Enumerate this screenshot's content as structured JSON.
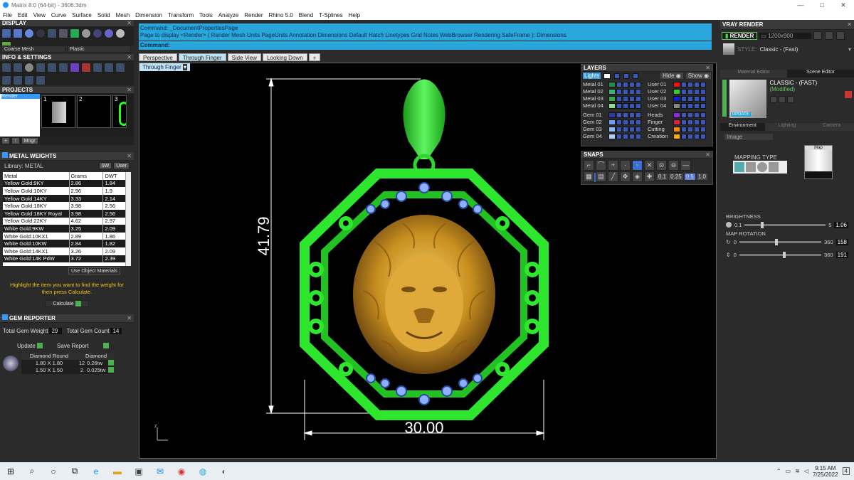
{
  "window": {
    "title": "Matrix 8.0 (64-bit) - 3606.3dm",
    "controls": [
      "—",
      "□",
      "✕"
    ]
  },
  "menu": [
    "File",
    "Edit",
    "View",
    "Curve",
    "Surface",
    "Solid",
    "Mesh",
    "Dimension",
    "Transform",
    "Tools",
    "Analyze",
    "Render",
    "Rhino 5.0",
    "Blend",
    "T-Splines",
    "Help"
  ],
  "left": {
    "display": {
      "title": "DISPLAY",
      "dropdown1": "Coarse Mesh",
      "dropdown2": "Plastic"
    },
    "info": {
      "title": "INFO & SETTINGS"
    },
    "projects": {
      "title": "PROJECTS",
      "item": "Render",
      "thumbs": [
        "1",
        "2",
        "3"
      ],
      "buttons": [
        "+",
        "↑",
        "Mngr"
      ]
    },
    "metal": {
      "title": "METAL WEIGHTS",
      "library_label": "Library: METAL",
      "toggle1": "0W",
      "toggle2": "User",
      "columns": [
        "Metal",
        "Grams",
        "DWT"
      ],
      "rows": [
        [
          "Yellow Gold:9KY",
          "2.86",
          "1.84"
        ],
        [
          "Yellow Gold:10KY",
          "2.96",
          "1.9"
        ],
        [
          "Yellow Gold:14KY",
          "3.33",
          "2.14"
        ],
        [
          "Yellow Gold:18KY",
          "3.98",
          "2.56"
        ],
        [
          "Yellow Gold:18KY Royal",
          "3.98",
          "2.56"
        ],
        [
          "Yellow Gold:22KY",
          "4.62",
          "2.97"
        ],
        [
          "White Gold:9KW",
          "3.25",
          "2.09"
        ],
        [
          "White Gold:10KX1",
          "2.89",
          "1.86"
        ],
        [
          "White Gold:10KW",
          "2.84",
          "1.82"
        ],
        [
          "White Gold:14KX1",
          "3.26",
          "2.09"
        ],
        [
          "White Gold:14K PdW",
          "3.72",
          "2.39"
        ]
      ],
      "use_object": "Use Object Materials",
      "hint": "Highlight the item you want to find the weight for then press Calculate.",
      "calculate": "Calculate"
    },
    "gem": {
      "title": "GEM REPORTER",
      "total_weight_label": "Total Gem Weight",
      "total_weight": "29",
      "total_count_label": "Total Gem Count",
      "total_count": "14",
      "update": "Update",
      "save": "Save Report",
      "columns": [
        "Diamond Round",
        "",
        "Diamond"
      ],
      "rows": [
        [
          "1.80 X 1.80",
          "12",
          "0.26tw"
        ],
        [
          "1.50 X 1.50",
          "2",
          "0.025tw"
        ]
      ]
    }
  },
  "command": {
    "line1": "Command: _DocumentPropertiesPage",
    "line2": "Page to display <Render> ( Render  Mesh  Units  PageUnits  Annotation  Dimensions  Default  Hatch  Linetypes  Grid  Notes  WebBrowser  Rendering  SafeFrame ): Dimensions",
    "prompt": "Command:"
  },
  "tabs": [
    "Perspective",
    "Through Finger",
    "Side View",
    "Looking Down",
    "+"
  ],
  "viewport_label": "Through Finger",
  "dims": {
    "height": "41.79",
    "width": "30.00"
  },
  "layers": {
    "title": "LAYERS",
    "lights": "Lights",
    "hide": "Hide",
    "show": "Show",
    "left": [
      {
        "name": "Metal 01",
        "color": "#1f8a4c"
      },
      {
        "name": "Metal 02",
        "color": "#3cb371"
      },
      {
        "name": "Metal 03",
        "color": "#34a853"
      },
      {
        "name": "Metal 04",
        "color": "#8fdc8f"
      },
      {
        "name": "Gem 01",
        "color": "#2a3a9e"
      },
      {
        "name": "Gem 02",
        "color": "#6ea0ff"
      },
      {
        "name": "Gem 03",
        "color": "#8fb8ff"
      },
      {
        "name": "Gem 04",
        "color": "#b7cffb"
      }
    ],
    "right": [
      {
        "name": "User 01",
        "color": "#e11"
      },
      {
        "name": "User 02",
        "color": "#3c3"
      },
      {
        "name": "User 03",
        "color": "#12c"
      },
      {
        "name": "User 04",
        "color": "#888"
      },
      {
        "name": "Heads",
        "color": "#8a2be2"
      },
      {
        "name": "Finger",
        "color": "#d24"
      },
      {
        "name": "Cutting",
        "color": "#f80"
      },
      {
        "name": "Creation",
        "color": "#fa0"
      }
    ]
  },
  "snaps": {
    "title": "SNAPS",
    "values": [
      "0.1",
      "0.25",
      "0.5",
      "1.0"
    ]
  },
  "vray": {
    "title": "VRAY RENDER",
    "render_btn": "RENDER",
    "size": "1200x900",
    "style_label": "STYLE:",
    "style_value": "Classic - (Fast)",
    "tabs": [
      "Material Editor",
      "Scene Editor"
    ],
    "preset": "CLASSIC - (FAST)",
    "modified": "(Modified)",
    "update": "UPDATE",
    "subtabs": [
      "Environment",
      "Lighting",
      "Camera"
    ],
    "env_select": "Image",
    "mapping_type": "MAPPING TYPE",
    "map_label": "Map",
    "brightness_label": "BRIGHTNESS",
    "brightness_min": "0.1",
    "brightness_max": "5",
    "brightness_val": "1.06",
    "rotation_label": "MAP ROTATION",
    "rot1_min": "0",
    "rot1_max": "360",
    "rot1_val": "158",
    "rot2_min": "0",
    "rot2_max": "360",
    "rot2_val": "191"
  },
  "taskbar": {
    "time": "9:15 AM",
    "date": "7/25/2022",
    "notif": "4"
  }
}
